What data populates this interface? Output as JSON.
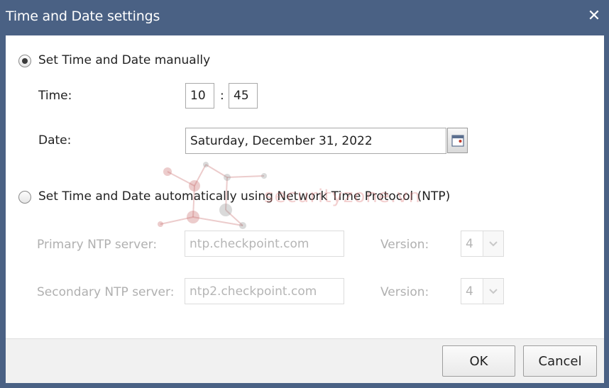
{
  "dialog": {
    "title": "Time and Date settings",
    "close_icon": "close-icon"
  },
  "manual": {
    "radio_label": "Set Time and Date manually",
    "selected": true,
    "time_label": "Time:",
    "hour": "10",
    "minute": "45",
    "separator": ":",
    "date_label": "Date:",
    "date_value": "Saturday, December 31, 2022",
    "calendar_icon": "calendar-icon"
  },
  "ntp": {
    "radio_label": "Set Time and Date automatically using Network Time Protocol (NTP)",
    "selected": false,
    "primary_label": "Primary NTP server:",
    "primary_value": "ntp.checkpoint.com",
    "primary_version_label": "Version:",
    "primary_version": "4",
    "secondary_label": "Secondary NTP server:",
    "secondary_value": "ntp2.checkpoint.com",
    "secondary_version_label": "Version:",
    "secondary_version": "4"
  },
  "watermark": {
    "text": "securityzone.vn"
  },
  "footer": {
    "ok_label": "OK",
    "cancel_label": "Cancel"
  },
  "colors": {
    "titlebar": "#4a6184",
    "panel": "#ffffff",
    "footer": "#f1f1f1",
    "disabled_text": "#b0b0b0"
  }
}
